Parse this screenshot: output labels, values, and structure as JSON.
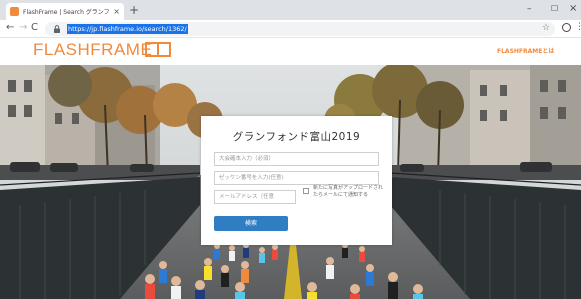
{
  "browser": {
    "tab_title": "FlashFrame | Search グランフォンド...",
    "tab_close": "×",
    "new_tab": "+",
    "url": "https://jp.flashframe.io/search/1362/",
    "window": {
      "minimize": "–",
      "maximize": "☐",
      "close": "×"
    },
    "nav": {
      "back": "←",
      "forward": "→",
      "reload": "C"
    },
    "star": "☆",
    "menu": "⋮"
  },
  "site": {
    "logo_text": "FLASHFRAME",
    "header_link": "FLASHFRAMEとは",
    "brand_color": "#f08a3e"
  },
  "search": {
    "title": "グランフォンド富山2019",
    "name_placeholder": "大会確本入力（必須）",
    "bib_placeholder": "ゼッケン番号を入力(任意)",
    "email_placeholder": "メールアドレス（任意",
    "notify_label": "新たに写真がアップロードされたらメールにて通知する",
    "notify_checked": false,
    "button_label": "検索",
    "button_color": "#2f7dc3"
  }
}
